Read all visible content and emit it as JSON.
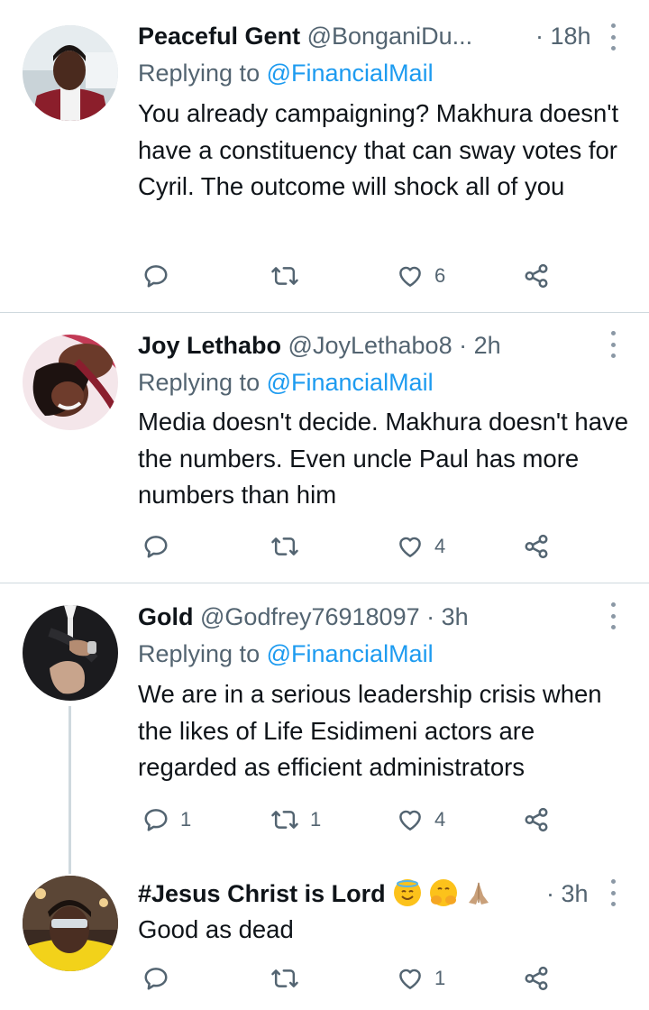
{
  "tweets": [
    {
      "name": "Peaceful Gent",
      "handle": "@BonganiDu...",
      "time": "· 18h",
      "replying_prefix": "Replying to",
      "replying_mention": "@FinancialMail",
      "text": "You already campaigning? Makhura doesn't have a constituency that can sway votes for Cyril. The outcome will shock all of you",
      "reply_count": "",
      "retweet_count": "",
      "like_count": "6"
    },
    {
      "name": "Joy Lethabo",
      "handle": "@JoyLethabo8",
      "time": "· 2h",
      "replying_prefix": "Replying to",
      "replying_mention": "@FinancialMail",
      "text": "Media doesn't decide. Makhura doesn't have the numbers. Even uncle Paul has more numbers than him",
      "reply_count": "",
      "retweet_count": "",
      "like_count": "4"
    },
    {
      "name": "Gold",
      "handle": "@Godfrey76918097",
      "time": "· 3h",
      "replying_prefix": "Replying to",
      "replying_mention": "@FinancialMail",
      "text": "We are in a serious leadership crisis when the likes of Life Esidimeni actors are regarded as efficient administrators",
      "reply_count": "1",
      "retweet_count": "1",
      "like_count": "4"
    },
    {
      "name": "#Jesus Christ is Lord",
      "emojis": [
        "smiling-face-with-halo-emoji",
        "hugging-face-emoji",
        "folded-hands-emoji"
      ],
      "time": "· 3h",
      "text": "Good as dead",
      "reply_count": "",
      "retweet_count": "",
      "like_count": "1"
    }
  ],
  "colors": {
    "text": "#0f1419",
    "secondary": "#536471",
    "mention": "#1d9bf0",
    "divider": "#cfd9de"
  }
}
